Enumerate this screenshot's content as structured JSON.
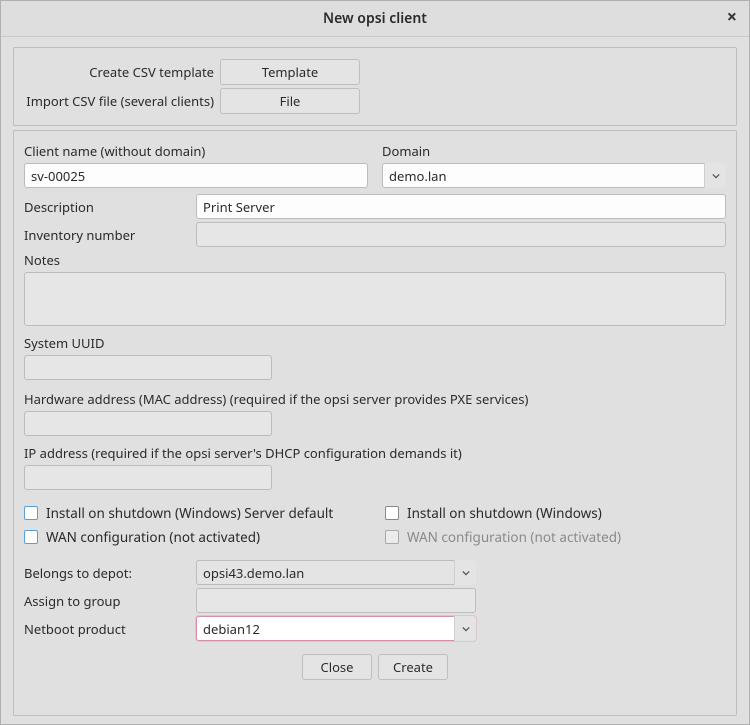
{
  "title": "New opsi client",
  "csv": {
    "createLabel": "Create CSV template",
    "createBtn": "Template",
    "importLabel": "Import CSV file (several clients)",
    "importBtn": "File"
  },
  "client": {
    "nameLabel": "Client name (without domain)",
    "nameValue": "sv-00025",
    "domainLabel": "Domain",
    "domainValue": "demo.lan",
    "descriptionLabel": "Description",
    "descriptionValue": "Print Server",
    "inventoryLabel": "Inventory number",
    "inventoryValue": "",
    "notesLabel": "Notes",
    "notesValue": "",
    "uuidLabel": "System UUID",
    "uuidValue": "",
    "macLabel": "Hardware address (MAC address)   (required if the opsi server provides PXE services)",
    "macValue": "",
    "ipLabel": "IP address   (required if the opsi server's DHCP configuration demands it)",
    "ipValue": ""
  },
  "checks": {
    "installDefault": "Install on shutdown (Windows) Server default",
    "install": "Install on shutdown (Windows)",
    "wanDefault": "WAN configuration (not activated)",
    "wan": "WAN configuration (not activated)"
  },
  "assign": {
    "depotLabel": "Belongs to depot:",
    "depotValue": "opsi43.demo.lan",
    "groupLabel": "Assign to group",
    "groupValue": "",
    "netbootLabel": "Netboot product",
    "netbootValue": "debian12"
  },
  "footer": {
    "close": "Close",
    "create": "Create"
  }
}
